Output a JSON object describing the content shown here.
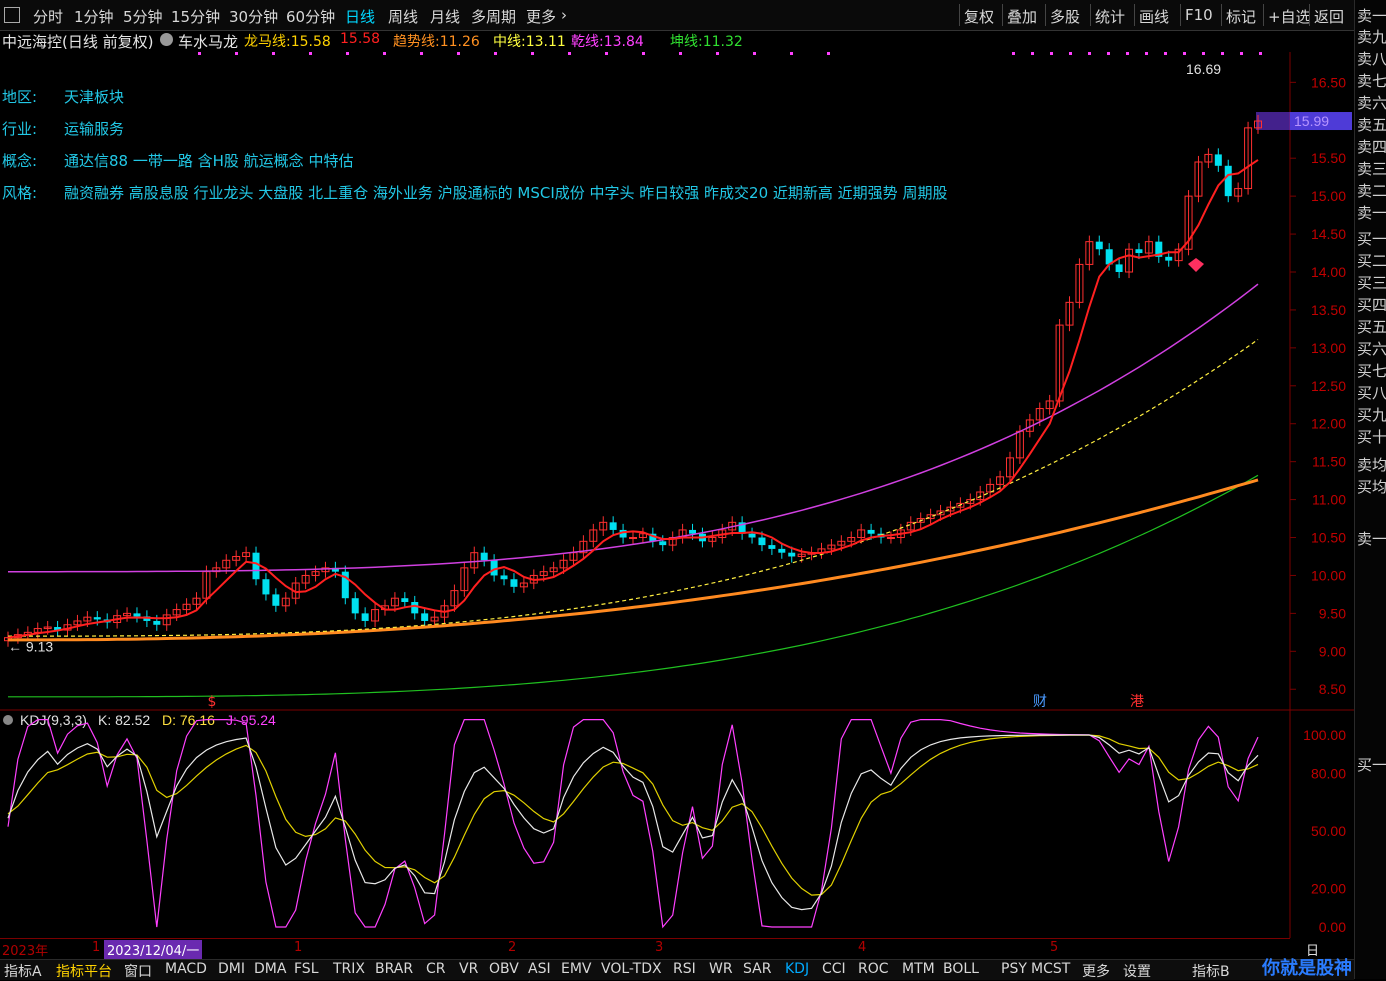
{
  "toolbar": {
    "left_items": [
      "分时",
      "1分钟",
      "5分钟",
      "15分钟",
      "30分钟",
      "60分钟",
      "日线",
      "周线",
      "月线",
      "多周期",
      "更多"
    ],
    "active": "日线",
    "right_items": [
      "复权",
      "叠加",
      "多股",
      "统计",
      "画线",
      "F10",
      "标记",
      "+自选",
      "返回"
    ]
  },
  "info": {
    "stock": "中远海控(日线 前复权)",
    "formula": "车水马龙",
    "indicators": [
      {
        "label": "龙马线:",
        "value": "15.58",
        "color": "#ffd200"
      },
      {
        "label": "",
        "value": "15.58",
        "color": "#ff2020"
      },
      {
        "label": "趋势线:",
        "value": "11.26",
        "color": "#ff9020"
      },
      {
        "label": "中线:",
        "value": "13.11",
        "color": "#ffff40"
      },
      {
        "label": "乾线:",
        "value": "13.84",
        "color": "#ff40ff"
      },
      {
        "label": "坤线:",
        "value": "11.32",
        "color": "#30e030"
      }
    ],
    "rows": [
      {
        "label": "地区:",
        "value": "天津板块"
      },
      {
        "label": "行业:",
        "value": "运输服务"
      },
      {
        "label": "概念:",
        "value": "通达信88 一带一路 含H股 航运概念 中特估"
      },
      {
        "label": "风格:",
        "value": "融资融券 高股息股 行业龙头 大盘股 北上重仓 海外业务 沪股通标的 MSCI成份 中字头 昨日较强 昨成交20 近期新高 近期强势 周期股"
      }
    ]
  },
  "chart_data": {
    "type": "candlestick",
    "price_axis": {
      "ticks": [
        "16.50",
        "16.00",
        "15.50",
        "15.00",
        "14.50",
        "14.00",
        "13.50",
        "13.00",
        "12.50",
        "12.00",
        "11.50",
        "11.00",
        "10.50",
        "10.00",
        "9.50",
        "9.00",
        "8.50"
      ],
      "ylim": [
        8.2,
        16.9
      ]
    },
    "current_price": "15.99",
    "high_label": "16.69",
    "low_label": "9.13",
    "closes": [
      9.18,
      9.22,
      9.25,
      9.3,
      9.32,
      9.28,
      9.35,
      9.4,
      9.45,
      9.42,
      9.38,
      9.47,
      9.5,
      9.46,
      9.4,
      9.35,
      9.48,
      9.55,
      9.62,
      9.7,
      10.05,
      10.1,
      10.2,
      10.25,
      10.3,
      9.95,
      9.75,
      9.6,
      9.7,
      9.9,
      10.0,
      10.05,
      10.1,
      10.05,
      9.7,
      9.5,
      9.4,
      9.55,
      9.6,
      9.7,
      9.65,
      9.5,
      9.4,
      9.45,
      9.6,
      9.8,
      10.1,
      10.3,
      10.2,
      10.0,
      9.95,
      9.85,
      9.9,
      10.0,
      10.05,
      10.1,
      10.2,
      10.3,
      10.45,
      10.6,
      10.7,
      10.6,
      10.5,
      10.5,
      10.55,
      10.45,
      10.4,
      10.5,
      10.6,
      10.55,
      10.45,
      10.5,
      10.6,
      10.7,
      10.55,
      10.5,
      10.4,
      10.35,
      10.3,
      10.25,
      10.28,
      10.3,
      10.35,
      10.4,
      10.45,
      10.5,
      10.6,
      10.55,
      10.5,
      10.5,
      10.6,
      10.7,
      10.75,
      10.8,
      10.85,
      10.9,
      10.95,
      11.0,
      11.1,
      11.2,
      11.3,
      11.55,
      11.9,
      12.05,
      12.2,
      12.3,
      13.3,
      13.6,
      14.1,
      14.4,
      14.3,
      14.1,
      14.0,
      14.3,
      14.25,
      14.4,
      14.2,
      14.15,
      14.3,
      15.0,
      15.45,
      15.55,
      15.4,
      15.0,
      15.1,
      15.9,
      15.99
    ],
    "series": [
      {
        "name": "乾线",
        "values_at_ends": [
          10.05,
          13.84
        ]
      },
      {
        "name": "中线",
        "values_at_ends": [
          9.2,
          13.11
        ]
      },
      {
        "name": "趋势线",
        "values_at_ends": [
          9.15,
          11.26
        ]
      },
      {
        "name": "坤线",
        "values_at_ends": [
          8.4,
          11.32
        ]
      }
    ],
    "markers": [
      {
        "label": "$"
      },
      {
        "label": "财"
      },
      {
        "label": "港"
      }
    ],
    "kdj": {
      "label": "KDJ(9,3,3)",
      "k": "K: 82.52",
      "d": "D: 76.16",
      "j": "J: 95.24",
      "ticks": [
        "100.00",
        "80.00",
        "50.00",
        "20.00",
        "0.00"
      ]
    },
    "time_axis": {
      "labels": [
        "2023年",
        "1",
        "2023/12/04/一",
        "1",
        "2",
        "3",
        "4",
        "5",
        "日线"
      ]
    }
  },
  "right_panel": {
    "items": [
      "卖一",
      "卖九",
      "卖八",
      "卖七",
      "卖六",
      "卖五",
      "卖四",
      "卖三",
      "卖二",
      "卖一",
      "买一",
      "买二",
      "买三",
      "买四",
      "买五",
      "买六",
      "买七",
      "买八",
      "买九",
      "买十",
      "卖均",
      "买均",
      "卖一",
      "买一"
    ]
  },
  "bottom_bar": {
    "items": [
      "指标A",
      "指标平台",
      "窗口",
      "MACD",
      "DMI",
      "DMA",
      "FSL",
      "TRIX",
      "BRAR",
      "CR",
      "VR",
      "OBV",
      "ASI",
      "EMV",
      "VOL-TDX",
      "RSI",
      "WR",
      "SAR",
      "KDJ",
      "CCI",
      "ROC",
      "MTM",
      "BOLL",
      "PSY",
      "MCST",
      "更多",
      "设置",
      "指标B"
    ],
    "highlight": "指标平台",
    "active": "KDJ"
  },
  "watermark": "你就是股神"
}
